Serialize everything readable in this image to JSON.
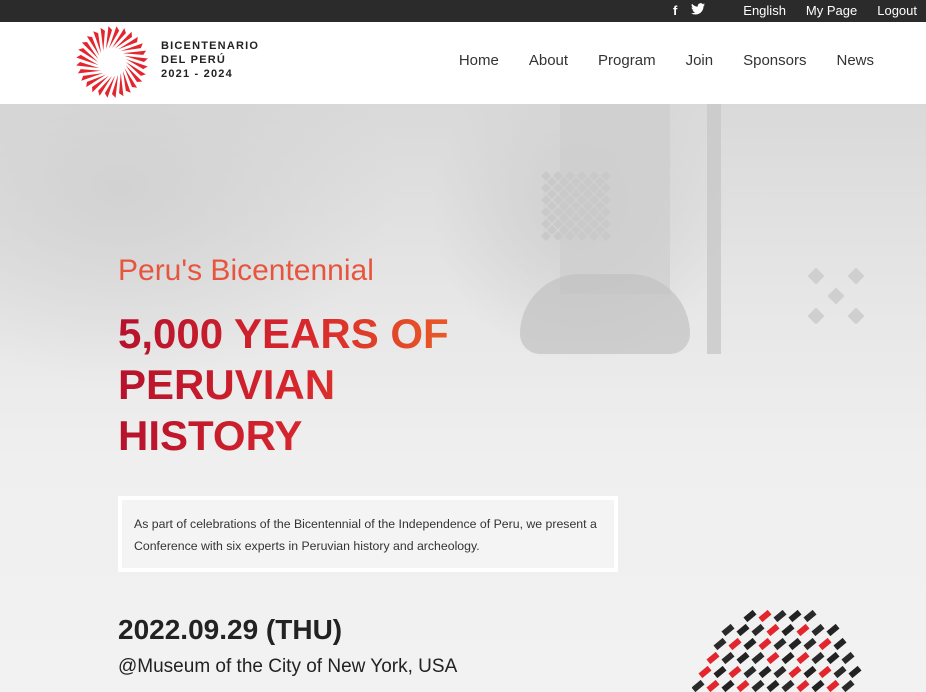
{
  "topbar": {
    "social_icons": [
      "facebook-icon",
      "twitter-icon"
    ],
    "facebook_glyph": "f",
    "twitter_glyph": "🐦",
    "language": "English",
    "my_page": "My Page",
    "logout": "Logout"
  },
  "brand": {
    "line1": "BICENTENARIO",
    "line2": "DEL PERÚ",
    "line3": "2021 - 2024",
    "logo_color": "#e3262d"
  },
  "nav": {
    "items": [
      "Home",
      "About",
      "Program",
      "Join",
      "Sponsors",
      "News"
    ]
  },
  "hero": {
    "subtitle": "Peru's Bicentennial",
    "title_line1": "5,000 YEARS OF",
    "title_line2": "PERUVIAN",
    "title_line3": "HISTORY",
    "description": "As part of celebrations of the Bicentennial of the Independence of Peru, we present a Conference with six experts in Peruvian history and archeology.",
    "date": "2022.09.29 (THU)",
    "venue": "@Museum of the City of New York, USA",
    "accent_red": "#d8272d",
    "accent_orange": "#f27a22"
  }
}
